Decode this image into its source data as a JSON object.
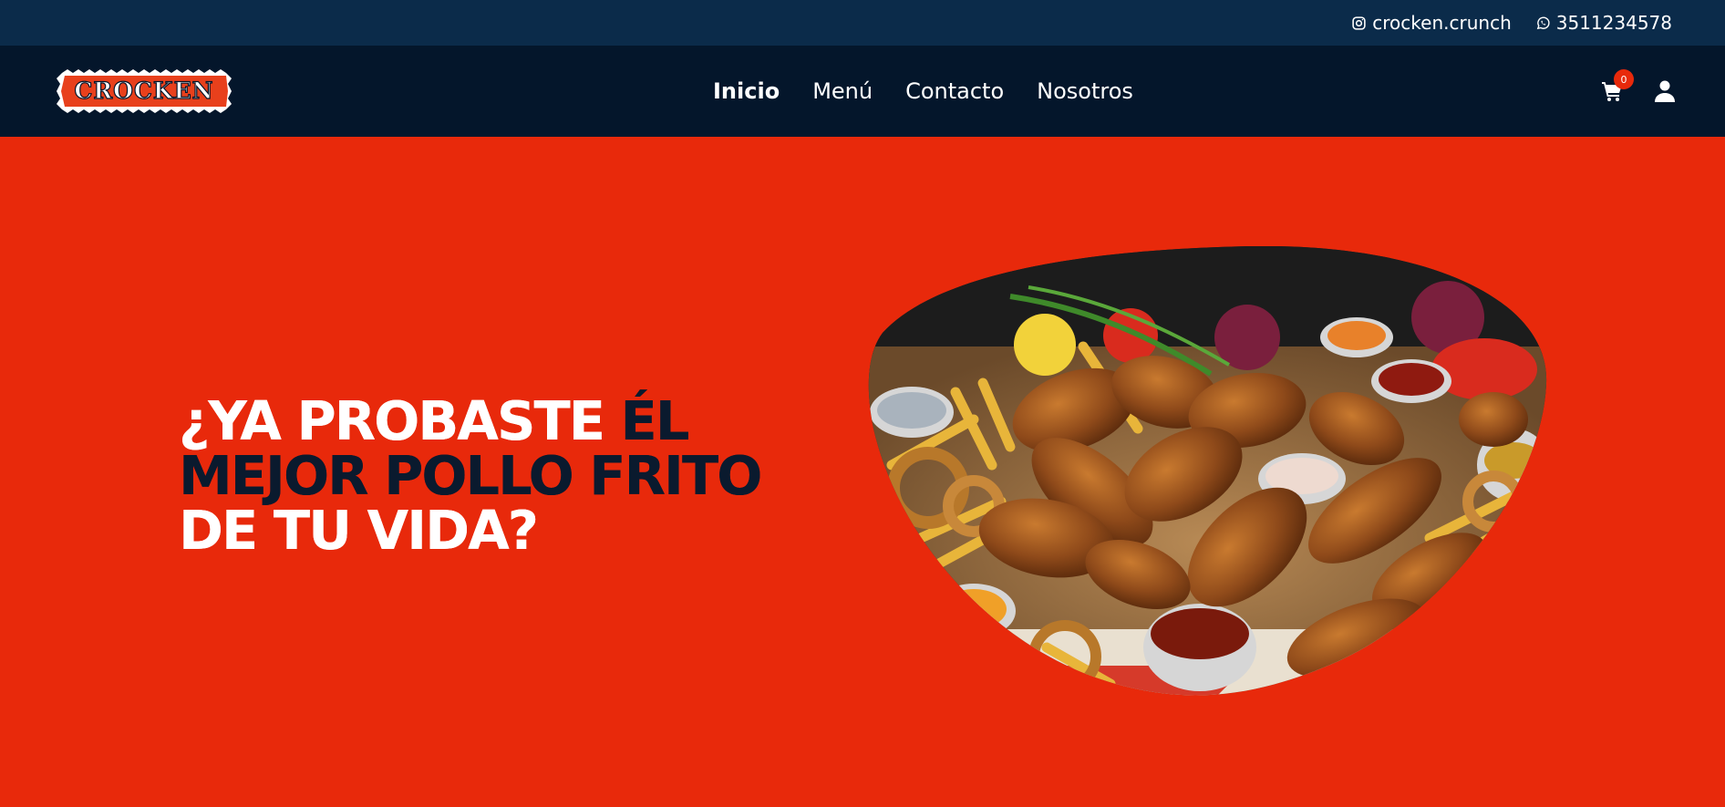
{
  "topbar": {
    "instagram_icon": "instagram-icon",
    "instagram_handle": "crocken.crunch",
    "whatsapp_icon": "whatsapp-icon",
    "phone": "3511234578"
  },
  "brand": {
    "logo_text": "CROCKEN"
  },
  "nav": {
    "items": [
      {
        "label": "Inicio",
        "active": true
      },
      {
        "label": "Menú",
        "active": false
      },
      {
        "label": "Contacto",
        "active": false
      },
      {
        "label": "Nosotros",
        "active": false
      }
    ]
  },
  "cart": {
    "icon": "cart-icon",
    "count": "0"
  },
  "user": {
    "icon": "user-icon"
  },
  "hero": {
    "title_part1": "¿YA PROBASTE ",
    "title_part2": "ÉL MEJOR POLLO FRITO",
    "title_part3": " DE TU VIDA?",
    "image_alt": "Fried chicken platter with fries and dipping sauces"
  },
  "colors": {
    "topbar": "#0b2b4a",
    "navbar": "#04162b",
    "hero_bg": "#e8290b",
    "accent_dark": "#0a1a2e",
    "logo_red": "#e8401c"
  }
}
